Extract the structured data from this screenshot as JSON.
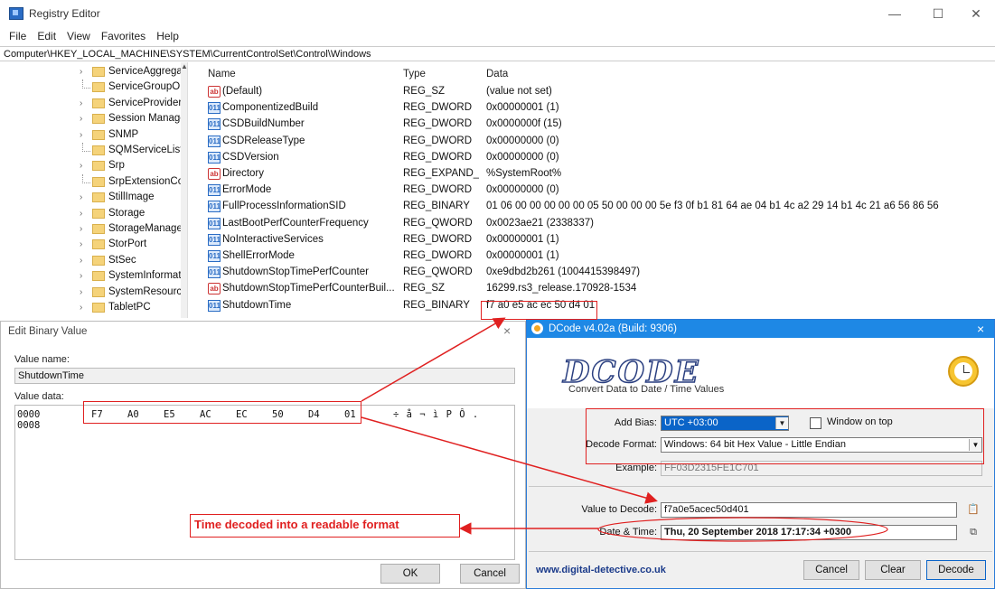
{
  "registry": {
    "title": "Registry Editor",
    "menu": [
      "File",
      "Edit",
      "View",
      "Favorites",
      "Help"
    ],
    "address": "Computer\\HKEY_LOCAL_MACHINE\\SYSTEM\\CurrentControlSet\\Control\\Windows",
    "tree": [
      {
        "label": "ServiceAggregat",
        "expandable": true
      },
      {
        "label": "ServiceGroupOr",
        "expandable": false
      },
      {
        "label": "ServiceProvider",
        "expandable": true
      },
      {
        "label": "Session Manage",
        "expandable": true
      },
      {
        "label": "SNMP",
        "expandable": true
      },
      {
        "label": "SQMServiceList",
        "expandable": false
      },
      {
        "label": "Srp",
        "expandable": true
      },
      {
        "label": "SrpExtensionCor",
        "expandable": false
      },
      {
        "label": "StillImage",
        "expandable": true
      },
      {
        "label": "Storage",
        "expandable": true
      },
      {
        "label": "StorageManager",
        "expandable": true
      },
      {
        "label": "StorPort",
        "expandable": true
      },
      {
        "label": "StSec",
        "expandable": true
      },
      {
        "label": "SystemInformat",
        "expandable": true
      },
      {
        "label": "SystemResource",
        "expandable": true
      },
      {
        "label": "TabletPC",
        "expandable": true
      }
    ],
    "columns": {
      "name": "Name",
      "type": "Type",
      "data": "Data"
    },
    "rows": [
      {
        "icon": "ab",
        "name": "(Default)",
        "type": "REG_SZ",
        "data": "(value not set)"
      },
      {
        "icon": "bin",
        "name": "ComponentizedBuild",
        "type": "REG_DWORD",
        "data": "0x00000001 (1)"
      },
      {
        "icon": "bin",
        "name": "CSDBuildNumber",
        "type": "REG_DWORD",
        "data": "0x0000000f (15)"
      },
      {
        "icon": "bin",
        "name": "CSDReleaseType",
        "type": "REG_DWORD",
        "data": "0x00000000 (0)"
      },
      {
        "icon": "bin",
        "name": "CSDVersion",
        "type": "REG_DWORD",
        "data": "0x00000000 (0)"
      },
      {
        "icon": "ab",
        "name": "Directory",
        "type": "REG_EXPAND_...",
        "data": "%SystemRoot%"
      },
      {
        "icon": "bin",
        "name": "ErrorMode",
        "type": "REG_DWORD",
        "data": "0x00000000 (0)"
      },
      {
        "icon": "bin",
        "name": "FullProcessInformationSID",
        "type": "REG_BINARY",
        "data": "01 06 00 00 00 00 00 05 50 00 00 00 5e f3 0f b1 81 64 ae 04 b1 4c a2 29 14 b1 4c 21 a6 56 86 56"
      },
      {
        "icon": "bin",
        "name": "LastBootPerfCounterFrequency",
        "type": "REG_QWORD",
        "data": "0x0023ae21 (2338337)"
      },
      {
        "icon": "bin",
        "name": "NoInteractiveServices",
        "type": "REG_DWORD",
        "data": "0x00000001 (1)"
      },
      {
        "icon": "bin",
        "name": "ShellErrorMode",
        "type": "REG_DWORD",
        "data": "0x00000001 (1)"
      },
      {
        "icon": "bin",
        "name": "ShutdownStopTimePerfCounter",
        "type": "REG_QWORD",
        "data": "0xe9dbd2b261 (1004415398497)"
      },
      {
        "icon": "ab",
        "name": "ShutdownStopTimePerfCounterBuil...",
        "type": "REG_SZ",
        "data": "16299.rs3_release.170928-1534"
      },
      {
        "icon": "bin",
        "name": "ShutdownTime",
        "type": "REG_BINARY",
        "data": "f7 a0 e5 ac ec 50 d4 01"
      }
    ]
  },
  "edit_binary": {
    "title": "Edit Binary Value",
    "close": "×",
    "value_name_label": "Value name:",
    "value_name": "ShutdownTime",
    "value_data_label": "Value data:",
    "offsets": [
      "0000",
      "0008"
    ],
    "bytes": [
      "F7",
      "A0",
      "E5",
      "AC",
      "EC",
      "50",
      "D4",
      "01"
    ],
    "ascii": "÷ å ¬ ì P Ô .",
    "ok": "OK",
    "cancel": "Cancel"
  },
  "dcode": {
    "title": "DCode v4.02a (Build: 9306)",
    "close": "×",
    "logo": "DCODE",
    "subtitle": "Convert Data to Date / Time Values",
    "add_bias_label": "Add Bias:",
    "add_bias": "UTC +03:00",
    "window_on_top": "Window on top",
    "decode_format_label": "Decode Format:",
    "decode_format": "Windows: 64 bit Hex Value - Little Endian",
    "example_label": "Example:",
    "example": "FF03D2315FE1C701",
    "value_label": "Value to Decode:",
    "value": "f7a0e5acec50d401",
    "datetime_label": "Date & Time:",
    "datetime": "Thu, 20 September 2018 17:17:34 +0300",
    "link": "www.digital-detective.co.uk",
    "cancel": "Cancel",
    "clear": "Clear",
    "decode": "Decode"
  },
  "annotation": {
    "text": "Time decoded into a readable format",
    "color": "#e02020"
  }
}
